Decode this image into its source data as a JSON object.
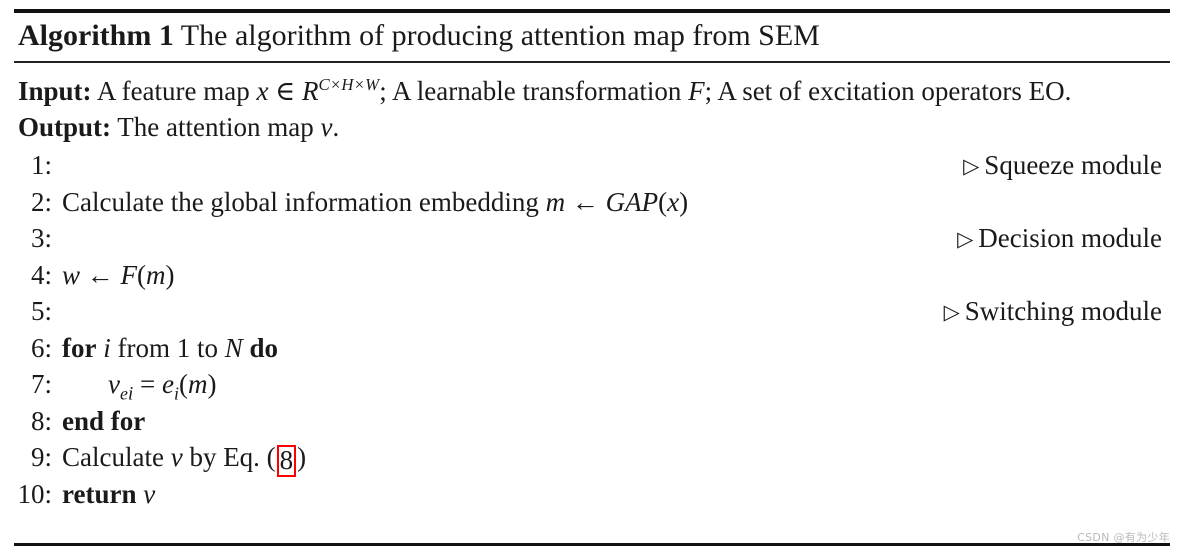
{
  "title": {
    "label": "Algorithm 1",
    "text": "The algorithm of producing attention map from SEM"
  },
  "io": {
    "input_label": "Input:",
    "input_text_a": "A feature map",
    "input_var_x": "x",
    "input_in": "∈",
    "input_var_R": "R",
    "input_sup": "C×H×W",
    "input_text_b": "; A learnable transformation",
    "input_var_F": "F",
    "input_text_c": "; A set of excitation operators EO.",
    "output_label": "Output:",
    "output_text": "The attention map",
    "output_var_v": "v",
    "output_period": "."
  },
  "steps": [
    {
      "num": "1:",
      "body": "",
      "comment": "Squeeze module",
      "comment_marker": "▷"
    },
    {
      "num": "2:",
      "text_a": "Calculate the global information embedding",
      "var_m": "m",
      "arrow": "←",
      "func_gap": "GAP",
      "paren_open": "(",
      "var_x": "x",
      "paren_close": ")",
      "comment": "",
      "comment_marker": ""
    },
    {
      "num": "3:",
      "body": "",
      "comment": "Decision module",
      "comment_marker": "▷"
    },
    {
      "num": "4:",
      "var_w": "w",
      "arrow": "←",
      "func_F": "F",
      "paren_open": "(",
      "var_m": "m",
      "paren_close": ")",
      "comment": "",
      "comment_marker": ""
    },
    {
      "num": "5:",
      "body": "",
      "comment": "Switching module",
      "comment_marker": "▷"
    },
    {
      "num": "6:",
      "kw_for": "for",
      "var_i": "i",
      "text_from": "from",
      "val_1": "1",
      "text_to": "to",
      "var_N": "N",
      "kw_do": "do"
    },
    {
      "num": "7:",
      "var_v": "v",
      "sub_e": "e",
      "subsub_i": "i",
      "eq": "=",
      "func_e": "e",
      "func_sub_i": "i",
      "paren_open": "(",
      "var_m": "m",
      "paren_close": ")"
    },
    {
      "num": "8:",
      "kw_end_for": "end for"
    },
    {
      "num": "9:",
      "text_a": "Calculate",
      "var_v": "v",
      "text_b": "by Eq. (",
      "eq_ref": "8",
      "text_c": ")"
    },
    {
      "num": "10:",
      "kw_return": "return",
      "var_v": "v"
    }
  ],
  "highlight": {
    "color": "#ff0000",
    "target": "8"
  },
  "watermark": "CSDN @有为少年"
}
